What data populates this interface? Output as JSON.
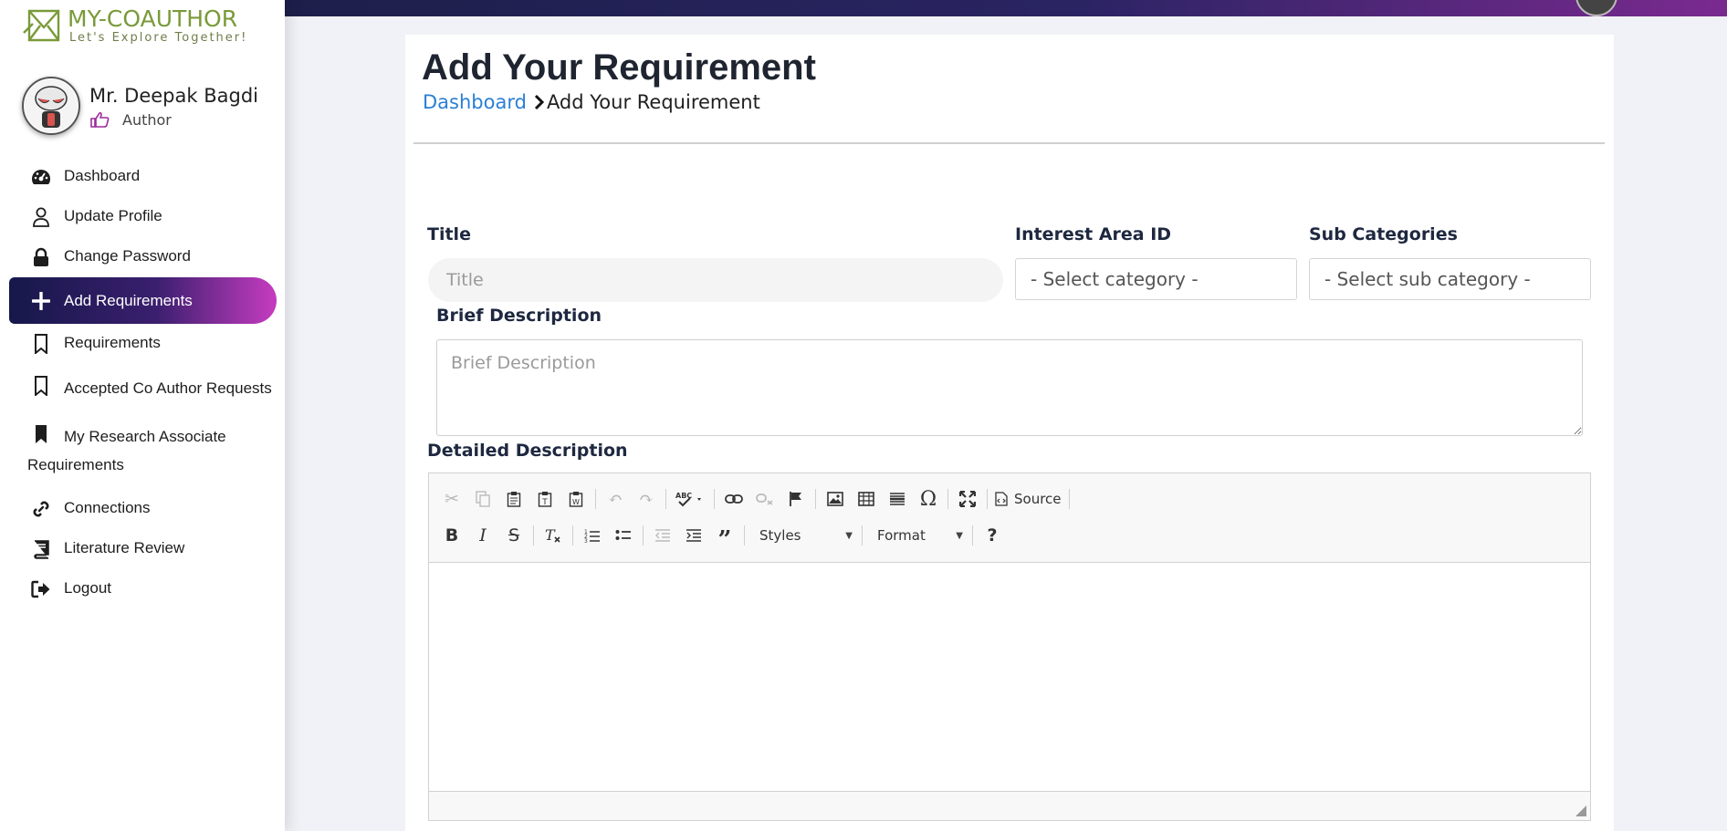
{
  "brand": {
    "title": "MY-COAUTHOR",
    "tagline": "Let's Explore Together!"
  },
  "user": {
    "name": "Mr. Deepak Bagdi",
    "role": "Author"
  },
  "sidebar": {
    "items": [
      {
        "label": "Dashboard",
        "icon": "gauge-icon"
      },
      {
        "label": "Update Profile",
        "icon": "user-icon"
      },
      {
        "label": "Change Password",
        "icon": "lock-icon"
      },
      {
        "label": "Add Requirements",
        "icon": "plus-icon",
        "active": true
      },
      {
        "label": "Requirements",
        "icon": "bookmark-icon"
      },
      {
        "label": "Accepted Co Author Requests",
        "icon": "bookmark-icon"
      },
      {
        "label": "My Research Associate Requirements",
        "icon": "bookmark-filled-icon"
      },
      {
        "label": "Connections",
        "icon": "link-icon"
      },
      {
        "label": "Literature Review",
        "icon": "book-icon"
      },
      {
        "label": "Logout",
        "icon": "logout-icon"
      }
    ]
  },
  "page": {
    "title": "Add Your Requirement",
    "breadcrumb": {
      "home": "Dashboard",
      "current": "Add Your Requirement"
    }
  },
  "form": {
    "title": {
      "label": "Title",
      "placeholder": "Title",
      "value": ""
    },
    "interest_area": {
      "label": "Interest Area ID",
      "selected": "- Select category -"
    },
    "sub_categories": {
      "label": "Sub Categories",
      "selected": "- Select sub category -"
    },
    "brief": {
      "label": "Brief Description",
      "placeholder": "Brief Description",
      "value": ""
    },
    "detailed": {
      "label": "Detailed Description"
    }
  },
  "editor": {
    "source_label": "Source",
    "styles_label": "Styles",
    "format_label": "Format",
    "help_label": "?"
  },
  "colors": {
    "accent_blue": "#2a7fd4",
    "brand_green": "#7a9a3a",
    "active_start": "#16184a",
    "active_end": "#c63cc0"
  }
}
